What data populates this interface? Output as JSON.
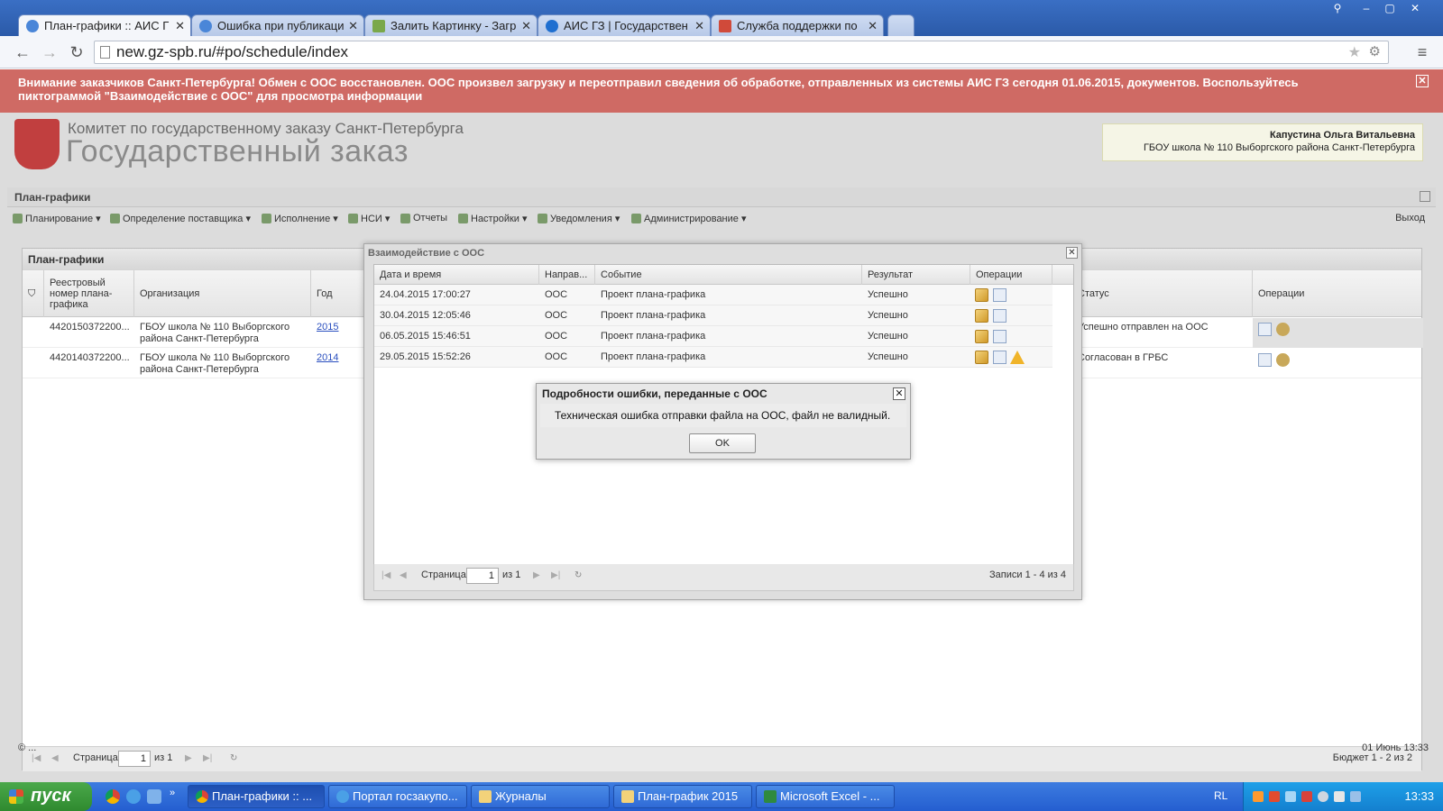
{
  "browser": {
    "tabs": [
      {
        "label": "План-графики :: АИС Г",
        "active": true
      },
      {
        "label": "Ошибка при публикаци",
        "active": false
      },
      {
        "label": "Залить Картинку - Загр",
        "active": false
      },
      {
        "label": "АИС ГЗ | Государствен",
        "active": false
      },
      {
        "label": "Служба поддержки по",
        "active": false
      }
    ],
    "url": "new.gz-spb.ru/#po/schedule/index"
  },
  "alert": {
    "text": "Внимание заказчиков Санкт-Петербурга! Обмен с ООС восстановлен. ООС произвел загрузку и переотправил сведения об обработке, отправленных из системы АИС ГЗ сегодня 01.06.2015, документов. Воспользуйтесь пиктограммой \"Взаимодействие с ООС\" для просмотра информации"
  },
  "header": {
    "committee": "Комитет по государственному заказу Санкт-Петербурга",
    "title": "Государственный заказ",
    "user_name": "Капустина Ольга Витальевна",
    "user_org": "ГБОУ школа № 110 Выборгского района Санкт-Петербурга"
  },
  "panel": {
    "title": "План-графики"
  },
  "toolbar": {
    "items": [
      "Планирование",
      "Определение поставщика",
      "Исполнение",
      "НСИ",
      "Отчеты",
      "Настройки",
      "Уведомления",
      "Администрирование"
    ],
    "logout": "Выход"
  },
  "grid": {
    "title": "План-графики",
    "columns": {
      "reg": "Реестровый номер плана-графика",
      "org": "Организация",
      "year": "Год",
      "status": "Статус",
      "ops": "Операции"
    },
    "rows": [
      {
        "reg": "4420150372200...",
        "org": "ГБОУ школа № 110 Выборгского района Санкт-Петербурга",
        "year": "2015",
        "status": "Успешно отправлен на ООС"
      },
      {
        "reg": "4420140372200...",
        "org": "ГБОУ школа № 110 Выборгского района Санкт-Петербурга",
        "year": "2014",
        "status": "Согласован в ГРБС"
      }
    ],
    "pager": {
      "page_label": "Страница",
      "page": "1",
      "of": "из 1",
      "summary": "Бюджет 1 - 2 из 2"
    }
  },
  "statusbar": {
    "left": "© ...",
    "right": "01 Июнь 13:33"
  },
  "dialog_ooc": {
    "title": "Взаимодействие с ООС",
    "columns": {
      "datetime": "Дата и время",
      "direction": "Направ...",
      "event": "Событие",
      "result": "Результат",
      "ops": "Операции"
    },
    "rows": [
      {
        "datetime": "24.04.2015 17:00:27",
        "direction": "ООС",
        "event": "Проект плана-графика",
        "result": "Успешно",
        "warning": false
      },
      {
        "datetime": "30.04.2015 12:05:46",
        "direction": "ООС",
        "event": "Проект плана-графика",
        "result": "Успешно",
        "warning": false
      },
      {
        "datetime": "06.05.2015 15:46:51",
        "direction": "ООС",
        "event": "Проект плана-графика",
        "result": "Успешно",
        "warning": false
      },
      {
        "datetime": "29.05.2015 15:52:26",
        "direction": "ООС",
        "event": "Проект плана-графика",
        "result": "Успешно",
        "warning": true
      }
    ],
    "pager": {
      "page_label": "Страница",
      "page": "1",
      "of": "из 1",
      "summary": "Записи 1 - 4 из 4"
    }
  },
  "dialog_error": {
    "title": "Подробности ошибки, переданные с ООС",
    "message": "Техническая ошибка отправки файла на ООС, файл не валидный.",
    "ok": "OK"
  },
  "taskbar": {
    "start": "пуск",
    "buttons": [
      {
        "label": "План-графики :: ...",
        "active": true
      },
      {
        "label": "Портал госзакупо...",
        "active": false
      },
      {
        "label": "Журналы",
        "active": false
      },
      {
        "label": "План-график 2015",
        "active": false
      },
      {
        "label": "Microsoft Excel - ...",
        "active": false
      }
    ],
    "lang": "RL",
    "clock": "13:33"
  }
}
